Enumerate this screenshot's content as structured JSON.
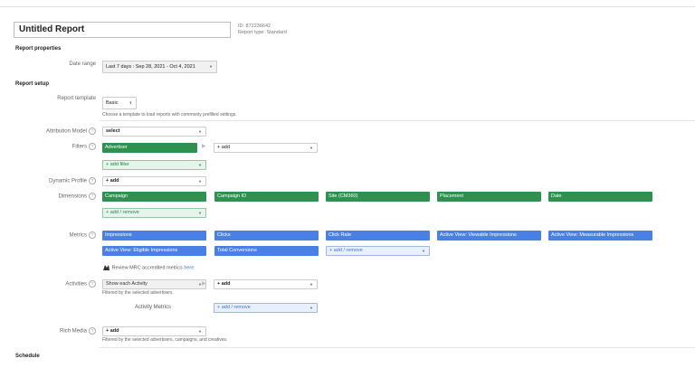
{
  "report": {
    "title": "Untitled Report",
    "id": "ID: 872236642",
    "type": "Report type: Standard"
  },
  "sections": {
    "properties": "Report properties",
    "setup": "Report setup",
    "schedule": "Schedule"
  },
  "labels": {
    "date_range": "Date range",
    "template": "Report template",
    "attribution": "Attribution Model",
    "filters": "Filters",
    "dynamic_profile": "Dynamic Profile",
    "dimensions": "Dimensions",
    "metrics": "Metrics",
    "activities": "Activities",
    "activity_metrics": "Activity Metrics",
    "rich_media": "Rich Media"
  },
  "help_glyph": "?",
  "date_range_value": "Last 7 days : Sep 28, 2021 - Oct 4, 2021",
  "template": {
    "value": "Basic",
    "hint": "Choose a template to load reports with commonly prefilled settings."
  },
  "attribution_value": "select",
  "filters": {
    "chip": "Advertiser",
    "add": "+ add",
    "add_filter": "+ add filter"
  },
  "dynamic_profile_value": "+ add",
  "dimensions": {
    "chips": [
      "Campaign",
      "Campaign ID",
      "Site (CM360)",
      "Placement",
      "Date"
    ],
    "add_remove": "+ add / remove"
  },
  "metrics": {
    "row1": [
      "Impressions",
      "Clicks",
      "Click Rate",
      "Active View: Viewable Impressions",
      "Active View: Measurable Impressions"
    ],
    "row2": [
      "Active View: Eligible Impressions",
      "Total Conversions"
    ],
    "add_remove": "+ add / remove",
    "mrc_text": "Review MRC accredited metrics",
    "mrc_link": "here"
  },
  "activities": {
    "value": "Show each Activity",
    "add": "+ add",
    "hint": "Filtered by the selected advertisers.",
    "metrics_add": "+ add / remove"
  },
  "rich_media": {
    "value": "+ add",
    "hint": "Filtered by the selected advertisers, campaigns, and creatives."
  },
  "glyphs": {
    "caret": "▼",
    "updown": "⬍",
    "arrow": "▶"
  },
  "icons": {
    "mrc": "mrc-badge-icon",
    "help": "help-circle-icon"
  }
}
